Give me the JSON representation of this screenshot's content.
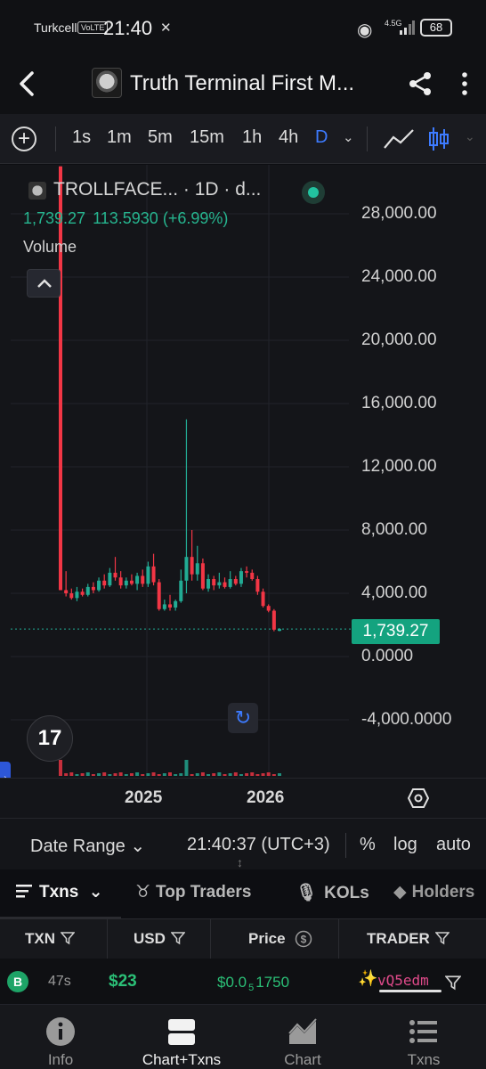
{
  "status_bar": {
    "carrier": "Turkcell",
    "volte": "VoLTE",
    "time": "21:40",
    "network": "4.5G",
    "battery": "68"
  },
  "header": {
    "title": "Truth Terminal First M..."
  },
  "toolbar": {
    "timeframes": [
      "1s",
      "1m",
      "5m",
      "15m",
      "1h",
      "4h",
      "D"
    ],
    "active_timeframe": "D",
    "accent": "#3d7bff"
  },
  "chart": {
    "legend_name": "TROLLFACE... · 1D · d...",
    "legend_close": "1,739.27",
    "legend_change": "113.5930 (+6.99%)",
    "volume_label": "Volume",
    "price_ticks": [
      "28,000.00",
      "24,000.00",
      "20,000.00",
      "16,000.00",
      "12,000.00",
      "8,000.00",
      "4,000.00",
      "0.0000",
      "-4,000.0000"
    ],
    "last_price": "1,739.27",
    "years": [
      "2025",
      "2026"
    ],
    "up_color": "#22ab94",
    "down_color": "#f23645"
  },
  "chart_data": {
    "type": "candlestick",
    "ylim": [
      -6500,
      31000
    ],
    "y_ticks": [
      28000,
      24000,
      20000,
      16000,
      12000,
      8000,
      4000,
      0,
      -4000
    ],
    "last_price": 1739.27,
    "candles": [
      {
        "o": 31000,
        "h": 31000,
        "l": 4200,
        "c": 4200
      },
      {
        "o": 4200,
        "h": 5400,
        "l": 3800,
        "c": 4000
      },
      {
        "o": 4000,
        "h": 4300,
        "l": 3600,
        "c": 3700
      },
      {
        "o": 3700,
        "h": 4400,
        "l": 3500,
        "c": 4100
      },
      {
        "o": 4100,
        "h": 4300,
        "l": 3800,
        "c": 3900
      },
      {
        "o": 3900,
        "h": 4600,
        "l": 3800,
        "c": 4400
      },
      {
        "o": 4400,
        "h": 4700,
        "l": 4000,
        "c": 4200
      },
      {
        "o": 4200,
        "h": 5000,
        "l": 4100,
        "c": 4800
      },
      {
        "o": 4800,
        "h": 5200,
        "l": 4300,
        "c": 4500
      },
      {
        "o": 4500,
        "h": 5600,
        "l": 4400,
        "c": 5300
      },
      {
        "o": 5300,
        "h": 6300,
        "l": 4800,
        "c": 5000
      },
      {
        "o": 5000,
        "h": 5400,
        "l": 4300,
        "c": 4500
      },
      {
        "o": 4500,
        "h": 5000,
        "l": 4300,
        "c": 4800
      },
      {
        "o": 4800,
        "h": 5200,
        "l": 4500,
        "c": 4600
      },
      {
        "o": 4600,
        "h": 5300,
        "l": 4200,
        "c": 5100
      },
      {
        "o": 5100,
        "h": 5500,
        "l": 4400,
        "c": 4600
      },
      {
        "o": 4600,
        "h": 6000,
        "l": 4400,
        "c": 5700
      },
      {
        "o": 5700,
        "h": 6500,
        "l": 4500,
        "c": 4700
      },
      {
        "o": 4700,
        "h": 4900,
        "l": 2900,
        "c": 3000
      },
      {
        "o": 3000,
        "h": 3600,
        "l": 2900,
        "c": 3300
      },
      {
        "o": 3300,
        "h": 3900,
        "l": 2900,
        "c": 3100
      },
      {
        "o": 3100,
        "h": 3600,
        "l": 2900,
        "c": 3500
      },
      {
        "o": 3500,
        "h": 5500,
        "l": 3400,
        "c": 4800
      },
      {
        "o": 4800,
        "h": 15000,
        "l": 4000,
        "c": 6300
      },
      {
        "o": 6300,
        "h": 8000,
        "l": 4800,
        "c": 5200
      },
      {
        "o": 5200,
        "h": 7000,
        "l": 4800,
        "c": 5900
      },
      {
        "o": 5900,
        "h": 6200,
        "l": 4200,
        "c": 4300
      },
      {
        "o": 4300,
        "h": 5200,
        "l": 4100,
        "c": 4900
      },
      {
        "o": 4900,
        "h": 5100,
        "l": 4200,
        "c": 4500
      },
      {
        "o": 4500,
        "h": 5300,
        "l": 4300,
        "c": 4700
      },
      {
        "o": 4700,
        "h": 5000,
        "l": 4300,
        "c": 4400
      },
      {
        "o": 4400,
        "h": 5400,
        "l": 4300,
        "c": 4900
      },
      {
        "o": 4900,
        "h": 5100,
        "l": 4500,
        "c": 4600
      },
      {
        "o": 4600,
        "h": 5600,
        "l": 4400,
        "c": 5400
      },
      {
        "o": 5400,
        "h": 5700,
        "l": 5000,
        "c": 5300
      },
      {
        "o": 5300,
        "h": 5500,
        "l": 4800,
        "c": 4900
      },
      {
        "o": 4900,
        "h": 5100,
        "l": 3900,
        "c": 4100
      },
      {
        "o": 4100,
        "h": 4300,
        "l": 3100,
        "c": 3200
      },
      {
        "o": 3200,
        "h": 3300,
        "l": 2800,
        "c": 2900
      },
      {
        "o": 2900,
        "h": 3000,
        "l": 1600,
        "c": 1700
      },
      {
        "o": 1625,
        "h": 1800,
        "l": 1600,
        "c": 1739
      }
    ]
  },
  "controls": {
    "date_range": "Date Range",
    "clock": "21:40:37 (UTC+3)",
    "percent": "%",
    "log": "log",
    "auto": "auto"
  },
  "tabs": [
    {
      "label": "Txns",
      "icon": "list-icon"
    },
    {
      "label": "Top Traders",
      "icon": "trophy-icon"
    },
    {
      "label": "KOLs",
      "icon": "microphone-icon"
    },
    {
      "label": "Holders",
      "icon": "diamond-icon"
    }
  ],
  "table": {
    "columns": [
      "TXN",
      "USD",
      "Price",
      "TRADER"
    ],
    "rows": [
      {
        "side": "B",
        "age": "47s",
        "usd": "$23",
        "price_prefix": "$0.0",
        "price_sub": "5",
        "price_digits": "1750",
        "trader": "vQ5edm"
      }
    ]
  },
  "bottom_nav": [
    {
      "label": "Info",
      "icon": "info-icon"
    },
    {
      "label": "Chart+Txns",
      "icon": "split-view-icon"
    },
    {
      "label": "Chart",
      "icon": "area-chart-icon"
    },
    {
      "label": "Txns",
      "icon": "list-icon"
    }
  ]
}
